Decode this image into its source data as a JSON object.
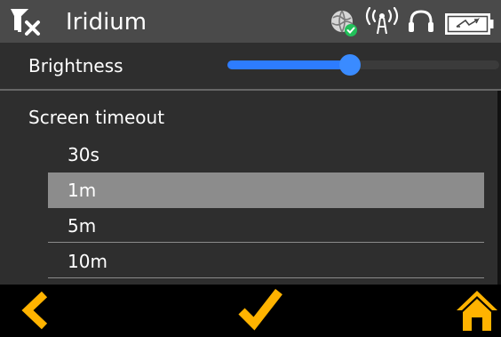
{
  "status_bar": {
    "title": "Iridium",
    "icons": [
      "no-signal-icon",
      "globe-check-icon",
      "antenna-broadcast-icon",
      "headset-icon",
      "battery-icon"
    ]
  },
  "brightness": {
    "label": "Brightness",
    "level": 0.45
  },
  "screen_timeout": {
    "label": "Screen timeout",
    "options": [
      "30s",
      "1m",
      "5m",
      "10m"
    ],
    "selected": "1m"
  },
  "nav": {
    "icons": [
      "back-chevron-icon",
      "confirm-check-icon",
      "home-icon"
    ]
  },
  "colors": {
    "accent": "#ffb300",
    "slider": "#2d7cff",
    "status_bar": "#4a4a4a",
    "panel": "#2e2e2e",
    "selected_row": "#8c8c8c"
  }
}
